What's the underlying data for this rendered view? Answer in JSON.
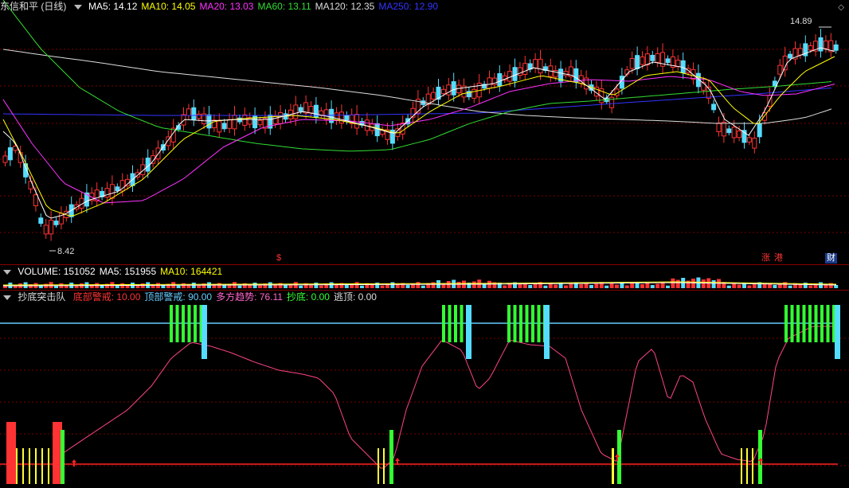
{
  "price_panel": {
    "title": "东信和平 (日线)",
    "ma_legend": [
      {
        "label": "MA5: 14.12",
        "color": "#ffffff"
      },
      {
        "label": "MA10: 14.05",
        "color": "#ffff00"
      },
      {
        "label": "MA20: 13.03",
        "color": "#ff33ff"
      },
      {
        "label": "MA60: 13.11",
        "color": "#33dd33"
      },
      {
        "label": "MA120: 12.35",
        "color": "#dddddd"
      },
      {
        "label": "MA250: 12.90",
        "color": "#3333ff"
      }
    ],
    "high_label": "14.89",
    "low_label": "8.42",
    "dollar_marker": "$",
    "event_tags": [
      "涨",
      "港",
      "财"
    ],
    "corner_icon": "diamond-icon"
  },
  "volume_panel": {
    "legend": [
      {
        "label": "VOLUME: 151052",
        "color": "#ffffff"
      },
      {
        "label": "MA5: 151955",
        "color": "#ffffff"
      },
      {
        "label": "MA10: 164421",
        "color": "#ffff00"
      }
    ]
  },
  "indicator_panel": {
    "name": "抄底突击队",
    "legend": [
      {
        "label": "底部警戒: 10.00",
        "color": "#ff3333"
      },
      {
        "label": "顶部警戒: 90.00",
        "color": "#66ccff"
      },
      {
        "label": "多方趋势: 76.11",
        "color": "#ff66cc"
      },
      {
        "label": "抄底: 0.00",
        "color": "#33ff33"
      },
      {
        "label": "逃顶: 0.00",
        "color": "#dddddd"
      }
    ]
  },
  "colors": {
    "up": "#ff3333",
    "down": "#55ddff",
    "grid": "#7a0000",
    "top_line": "#66ccff",
    "bottom_line": "#ff2222",
    "trend_line": "#ff4488",
    "buy_bar": "#33ff33",
    "warn_bar": "#ffff33"
  }
}
